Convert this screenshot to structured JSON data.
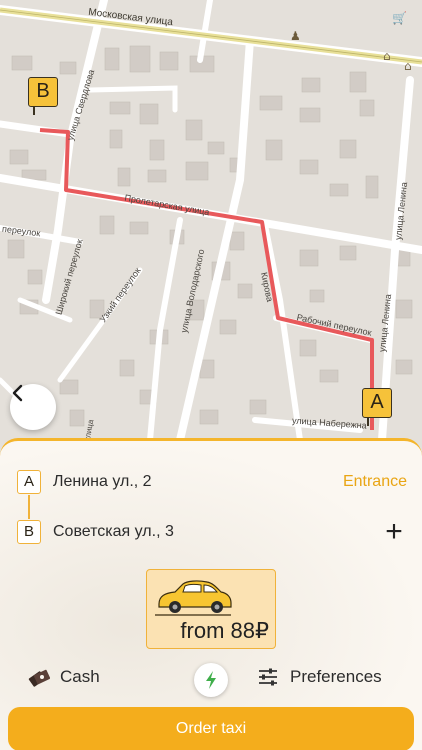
{
  "map": {
    "street_labels": {
      "moskovskaya": "Московская улица",
      "sverdlova": "улица Свердлова",
      "proletarskaya": "Пролетарская улица",
      "pereulok": "переулок",
      "shirokiy": "Широкий переулок",
      "uzkiy": "Узкий переулок",
      "volodarskogo": "улица Володарского",
      "lenina_vert": "улица Ленина",
      "lenina_mid": "улица Ленина",
      "rabochiy": "Рабочий переулок",
      "naberezhnaya": "улица Набережна",
      "kirova": "Кирова",
      "ulitsa_small": "улица"
    },
    "marker_a": "A",
    "marker_b": "B"
  },
  "route": {
    "point_a_letter": "A",
    "point_a_address": "Ленина ул., 2",
    "entrance_label": "Entrance",
    "point_b_letter": "B",
    "point_b_address": "Советская ул., 3",
    "add_stop_symbol": "+"
  },
  "tariff": {
    "price": "from 88₽"
  },
  "payment": {
    "method_label": "Cash"
  },
  "preferences_label": "Preferences",
  "order_button_label": "Order taxi",
  "colors": {
    "accent": "#f4ad1c",
    "route_line": "#e8595b",
    "marker": "#f6c23a"
  },
  "icons": {
    "back": "chevron-left-icon",
    "cash": "cash-icon",
    "bolt": "lightning-icon",
    "preferences": "sliders-icon",
    "car": "car-icon"
  }
}
